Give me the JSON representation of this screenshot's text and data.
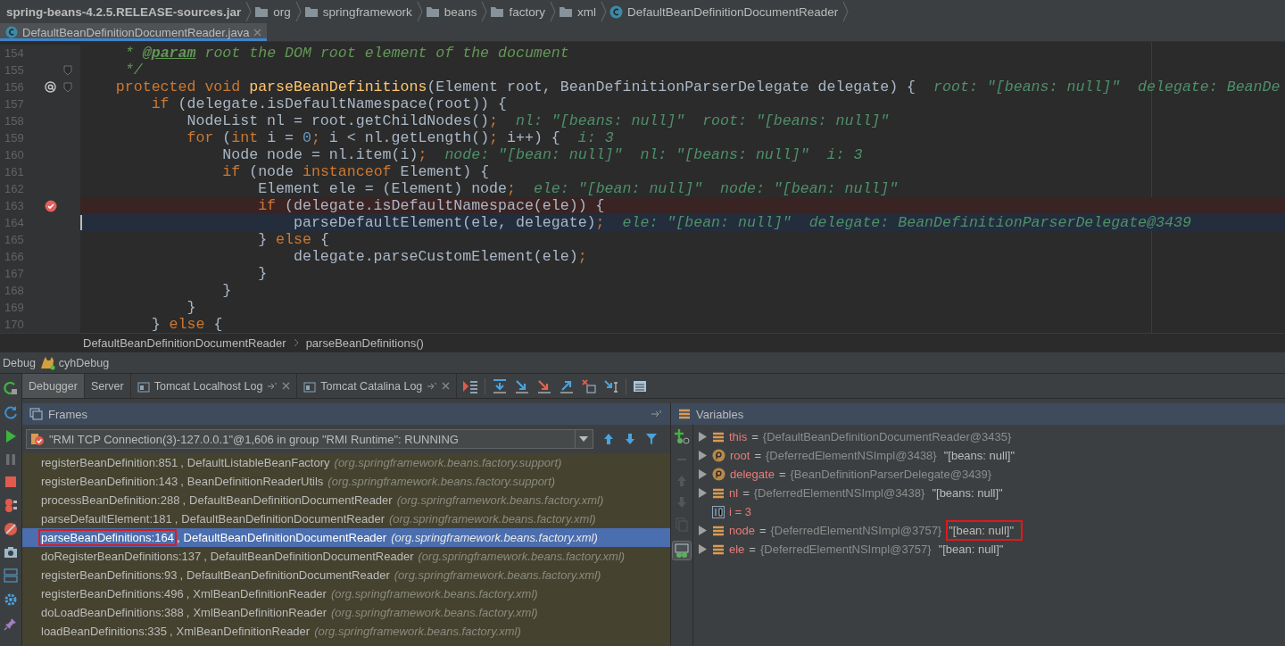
{
  "breadcrumb": [
    {
      "label": "spring-beans-4.2.5.RELEASE-sources.jar",
      "kind": "jar"
    },
    {
      "label": "org",
      "kind": "folder"
    },
    {
      "label": "springframework",
      "kind": "folder"
    },
    {
      "label": "beans",
      "kind": "folder"
    },
    {
      "label": "factory",
      "kind": "folder"
    },
    {
      "label": "xml",
      "kind": "folder"
    },
    {
      "label": "DefaultBeanDefinitionDocumentReader",
      "kind": "class"
    }
  ],
  "editor_tabs": [
    {
      "label": "DefaultBeanDefinitionDocumentReader.java",
      "selected": true
    }
  ],
  "code_lines": [
    {
      "number": "154",
      "override": false,
      "breakpoint": false,
      "current": false,
      "fold": false,
      "tokens": [
        {
          "text": "     * ",
          "kind": "comment"
        },
        {
          "text": "@param",
          "kind": "doctag"
        },
        {
          "text": " root the DOM root element of the document",
          "kind": "comment"
        }
      ]
    },
    {
      "number": "155",
      "override": false,
      "breakpoint": false,
      "current": false,
      "fold": true,
      "tokens": [
        {
          "text": "     */",
          "kind": "comment"
        }
      ]
    },
    {
      "number": "156",
      "override": true,
      "breakpoint": false,
      "current": false,
      "fold": true,
      "tokens": [
        {
          "text": "    protected void",
          "kind": "kw"
        },
        {
          "text": " parseBeanDefinitions",
          "kind": "decl"
        },
        {
          "text": "(Element root, BeanDefinitionParserDelegate delegate) {",
          "kind": "plain"
        }
      ],
      "hint": "root: \"[beans: null]\"  delegate: BeanDe"
    },
    {
      "number": "157",
      "override": false,
      "breakpoint": false,
      "current": false,
      "fold": false,
      "tokens": [
        {
          "text": "        if",
          "kind": "kw"
        },
        {
          "text": " (delegate.isDefaultNamespace(root)) {",
          "kind": "plain"
        }
      ]
    },
    {
      "number": "158",
      "override": false,
      "breakpoint": false,
      "current": false,
      "fold": false,
      "tokens": [
        {
          "text": "            NodeList nl = root.getChildNodes()",
          "kind": "plain"
        },
        {
          "text": ";",
          "kind": "kw"
        }
      ],
      "hint": "nl: \"[beans: null]\"  root: \"[beans: null]\""
    },
    {
      "number": "159",
      "override": false,
      "breakpoint": false,
      "current": false,
      "fold": false,
      "tokens": [
        {
          "text": "            for",
          "kind": "kw"
        },
        {
          "text": " (",
          "kind": "plain"
        },
        {
          "text": "int",
          "kind": "kw"
        },
        {
          "text": " i = ",
          "kind": "plain"
        },
        {
          "text": "0",
          "kind": "num"
        },
        {
          "text": ";",
          "kind": "kw"
        },
        {
          "text": " i < nl.getLength()",
          "kind": "plain"
        },
        {
          "text": ";",
          "kind": "kw"
        },
        {
          "text": " i++) {",
          "kind": "plain"
        }
      ],
      "hint": "i: 3"
    },
    {
      "number": "160",
      "override": false,
      "breakpoint": false,
      "current": false,
      "fold": false,
      "tokens": [
        {
          "text": "                Node node = nl.item(i)",
          "kind": "plain"
        },
        {
          "text": ";",
          "kind": "kw"
        }
      ],
      "hint": "node: \"[bean: null]\"  nl: \"[beans: null]\"  i: 3"
    },
    {
      "number": "161",
      "override": false,
      "breakpoint": false,
      "current": false,
      "fold": false,
      "tokens": [
        {
          "text": "                if",
          "kind": "kw"
        },
        {
          "text": " (node ",
          "kind": "plain"
        },
        {
          "text": "instanceof",
          "kind": "kw"
        },
        {
          "text": " Element) {",
          "kind": "plain"
        }
      ]
    },
    {
      "number": "162",
      "override": false,
      "breakpoint": false,
      "current": false,
      "fold": false,
      "tokens": [
        {
          "text": "                    Element ele = (Element) node",
          "kind": "plain"
        },
        {
          "text": ";",
          "kind": "kw"
        }
      ],
      "hint": "ele: \"[bean: null]\"  node: \"[bean: null]\""
    },
    {
      "number": "163",
      "override": false,
      "breakpoint": true,
      "current": false,
      "fold": false,
      "tokens": [
        {
          "text": "                    if",
          "kind": "kw"
        },
        {
          "text": " (delegate.isDefaultNamespace(ele)) {",
          "kind": "plain"
        }
      ]
    },
    {
      "number": "164",
      "override": false,
      "breakpoint": false,
      "current": true,
      "fold": false,
      "tokens": [
        {
          "text": "                        parseDefaultElement(ele, delegate)",
          "kind": "plain"
        },
        {
          "text": ";",
          "kind": "kw"
        }
      ],
      "hint": "ele: \"[bean: null]\"  delegate: BeanDefinitionParserDelegate@3439"
    },
    {
      "number": "165",
      "override": false,
      "breakpoint": false,
      "current": false,
      "fold": false,
      "tokens": [
        {
          "text": "                    } ",
          "kind": "plain"
        },
        {
          "text": "else",
          "kind": "kw"
        },
        {
          "text": " {",
          "kind": "plain"
        }
      ]
    },
    {
      "number": "166",
      "override": false,
      "breakpoint": false,
      "current": false,
      "fold": false,
      "tokens": [
        {
          "text": "                        delegate.parseCustomElement(ele)",
          "kind": "plain"
        },
        {
          "text": ";",
          "kind": "kw"
        }
      ]
    },
    {
      "number": "167",
      "override": false,
      "breakpoint": false,
      "current": false,
      "fold": false,
      "tokens": [
        {
          "text": "                    }",
          "kind": "plain"
        }
      ]
    },
    {
      "number": "168",
      "override": false,
      "breakpoint": false,
      "current": false,
      "fold": false,
      "tokens": [
        {
          "text": "                }",
          "kind": "plain"
        }
      ]
    },
    {
      "number": "169",
      "override": false,
      "breakpoint": false,
      "current": false,
      "fold": false,
      "tokens": [
        {
          "text": "            }",
          "kind": "plain"
        }
      ]
    },
    {
      "number": "170",
      "override": false,
      "breakpoint": false,
      "current": false,
      "fold": false,
      "tokens": [
        {
          "text": "        } ",
          "kind": "plain"
        },
        {
          "text": "else",
          "kind": "kw"
        },
        {
          "text": " {",
          "kind": "plain"
        }
      ]
    }
  ],
  "editor_breadcrumb": [
    "DefaultBeanDefinitionDocumentReader",
    "parseBeanDefinitions()"
  ],
  "debug_title": {
    "label": "Debug",
    "config": "cyhDebug"
  },
  "debug_tabs": [
    {
      "label": "Debugger",
      "selected": true,
      "closable": false
    },
    {
      "label": "Server",
      "selected": false,
      "closable": false
    },
    {
      "label": "Tomcat Localhost Log",
      "selected": false,
      "closable": true
    },
    {
      "label": "Tomcat Catalina Log",
      "selected": false,
      "closable": true
    }
  ],
  "frames": {
    "title": "Frames",
    "thread": "\"RMI TCP Connection(3)-127.0.0.1\"@1,606 in group \"RMI Runtime\": RUNNING",
    "items": [
      {
        "method": "registerBeanDefinition:851",
        "separator": ",",
        "class": "DefaultListableBeanFactory",
        "package": "(org.springframework.beans.factory.support)",
        "selected": false,
        "boxed": false
      },
      {
        "method": "registerBeanDefinition:143",
        "separator": ",",
        "class": "BeanDefinitionReaderUtils",
        "package": "(org.springframework.beans.factory.support)",
        "selected": false,
        "boxed": false
      },
      {
        "method": "processBeanDefinition:288",
        "separator": ",",
        "class": "DefaultBeanDefinitionDocumentReader",
        "package": "(org.springframework.beans.factory.xml)",
        "selected": false,
        "boxed": false
      },
      {
        "method": "parseDefaultElement:181",
        "separator": ",",
        "class": "DefaultBeanDefinitionDocumentReader",
        "package": "(org.springframework.beans.factory.xml)",
        "selected": false,
        "boxed": false
      },
      {
        "method": "parseBeanDefinitions:164",
        "separator": ",",
        "class": "DefaultBeanDefinitionDocumentReader",
        "package": "(org.springframework.beans.factory.xml)",
        "selected": true,
        "boxed": true
      },
      {
        "method": "doRegisterBeanDefinitions:137",
        "separator": ",",
        "class": "DefaultBeanDefinitionDocumentReader",
        "package": "(org.springframework.beans.factory.xml)",
        "selected": false,
        "boxed": false
      },
      {
        "method": "registerBeanDefinitions:93",
        "separator": ",",
        "class": "DefaultBeanDefinitionDocumentReader",
        "package": "(org.springframework.beans.factory.xml)",
        "selected": false,
        "boxed": false
      },
      {
        "method": "registerBeanDefinitions:496",
        "separator": ",",
        "class": "XmlBeanDefinitionReader",
        "package": "(org.springframework.beans.factory.xml)",
        "selected": false,
        "boxed": false
      },
      {
        "method": "doLoadBeanDefinitions:388",
        "separator": ",",
        "class": "XmlBeanDefinitionReader",
        "package": "(org.springframework.beans.factory.xml)",
        "selected": false,
        "boxed": false
      },
      {
        "method": "loadBeanDefinitions:335",
        "separator": ",",
        "class": "XmlBeanDefinitionReader",
        "package": "(org.springframework.beans.factory.xml)",
        "selected": false,
        "boxed": false
      }
    ]
  },
  "variables": {
    "title": "Variables",
    "items": [
      {
        "kind": "field",
        "name": "this",
        "assign": "=",
        "type": "{DefaultBeanDefinitionDocumentReader@3435}",
        "expandable": true
      },
      {
        "kind": "param",
        "name": "root",
        "assign": "=",
        "type": "{DeferredElementNSImpl@3438}",
        "value": "\"[beans: null]\"",
        "expandable": true,
        "boxed": false
      },
      {
        "kind": "param",
        "name": "delegate",
        "assign": "=",
        "type": "{BeanDefinitionParserDelegate@3439}",
        "expandable": true
      },
      {
        "kind": "field",
        "name": "nl",
        "assign": "=",
        "type": "{DeferredElementNSImpl@3438}",
        "value": "\"[beans: null]\"",
        "expandable": true,
        "boxed": false
      },
      {
        "kind": "primitive",
        "name": "i = 3",
        "expandable": false
      },
      {
        "kind": "field",
        "name": "node",
        "assign": "=",
        "type": "{DeferredElementNSImpl@3757}",
        "value": "\"[bean: null]\"",
        "expandable": true,
        "boxed": true
      },
      {
        "kind": "field",
        "name": "ele",
        "assign": "=",
        "type": "{DeferredElementNSImpl@3757}",
        "value": "\"[bean: null]\"",
        "expandable": true,
        "boxed": false
      }
    ]
  }
}
